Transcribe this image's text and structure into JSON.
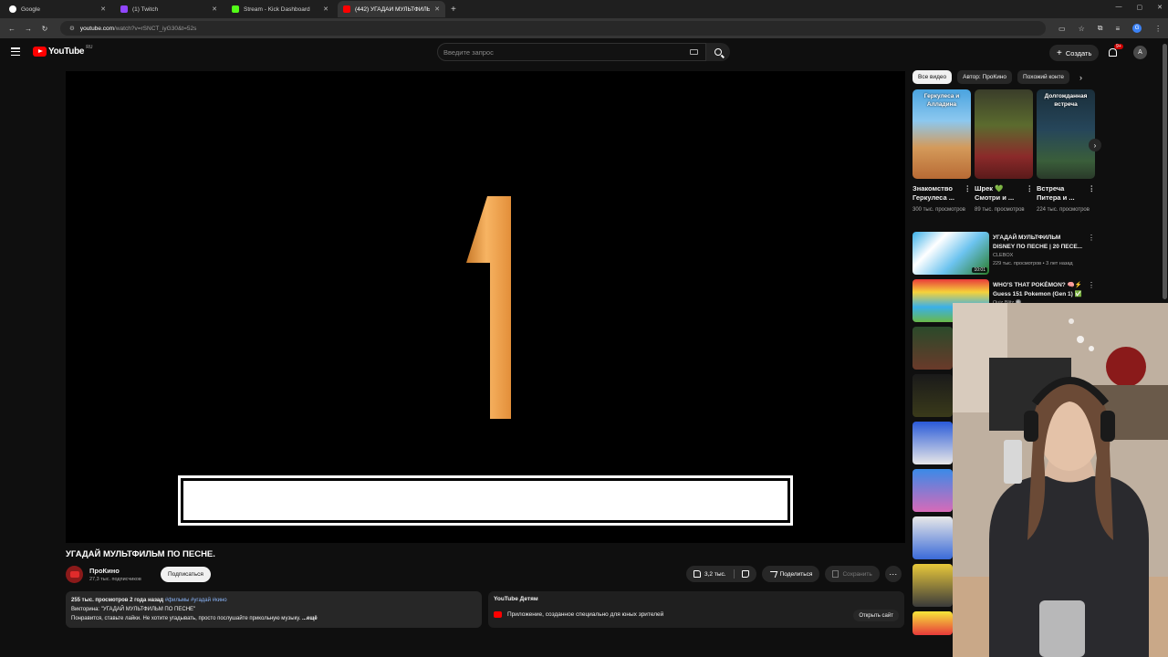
{
  "browser": {
    "tabs": [
      {
        "label": "Google",
        "color": "#ffffff"
      },
      {
        "label": "(1) Twitch",
        "color": "#9146ff"
      },
      {
        "label": "Stream - Kick Dashboard",
        "color": "#53fc18"
      },
      {
        "label": "(442) УГАДАЙ МУЛЬТФИЛЬ",
        "color": "#ff0000"
      }
    ],
    "url_site": "youtube.com",
    "url_rest": "/watch?v=rSNCT_iyG30&t=52s"
  },
  "header": {
    "logo_text": "YouTube",
    "region": "RU",
    "search_placeholder": "Введите запрос",
    "create_label": "Создать",
    "notif_badge": "9+",
    "avatar_letter": "А"
  },
  "player": {
    "countdown_number": "1",
    "countdown_color": "#f0a44b"
  },
  "video": {
    "title": "УГАДАЙ МУЛЬТФИЛЬМ ПО ПЕСНЕ.",
    "channel": "ПроКино",
    "subscribers": "27,3 тыс. подписчиков",
    "subscribe_label": "Подписаться",
    "likes": "3,2 тыс.",
    "share_label": "Поделиться",
    "save_label": "Сохранить",
    "views_date": "255 тыс. просмотров  2 года назад",
    "tags": "#фильмы #угадай #кино",
    "desc_line1": "Викторина: \"УГАДАЙ МУЛЬТФИЛЬМ ПО ПЕСНЕ\"",
    "desc_line2": "Понравится, ставьте лайки. Не хотите угадывать, просто послушайте прикольную музыку.",
    "more_label": "...ещё"
  },
  "kids_banner": {
    "title": "YouTube Детям",
    "text": "Приложение, созданное специально для юных зрителей",
    "open_label": "Открыть сайт"
  },
  "sidebar": {
    "chips": [
      "Все видео",
      "Автор: ПроКино",
      "Похожий конте"
    ],
    "shorts": [
      {
        "caption": "Геркулеса и Алладина",
        "title": "Знакомство Геркулеса ...",
        "views": "300 тыс. просмотров"
      },
      {
        "caption": "",
        "title": "Шрек 💚 Смотри и ...",
        "views": "89 тыс. просмотров"
      },
      {
        "caption": "Долгожданная встреча",
        "title": "Встреча Питера и ...",
        "views": "224 тыс. просмотров"
      }
    ],
    "recs": [
      {
        "title": "УГАДАЙ МУЛЬТФИЛЬМ DISNEY ПО ПЕСНЕ | 20 ПЕСЕ...",
        "channel": "CLEBOX",
        "meta": "229 тыс. просмотров • 3 лет назад",
        "duration": "10:01"
      },
      {
        "title": "WHO'S THAT POKÉMON? 🧠⚡ Guess 151 Pokemon (Gen 1) ✅",
        "channel": "Quiz Blitz 🔘",
        "meta": "",
        "duration": ""
      }
    ]
  }
}
